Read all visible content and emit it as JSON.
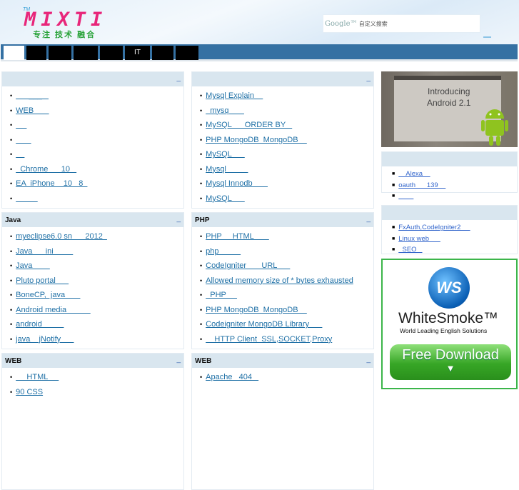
{
  "header": {
    "logo_tm": "TM",
    "logo": "MIXTI",
    "slogan": "专注 技术 融合",
    "search_google": "Google™",
    "search_placeholder": "自定义搜索"
  },
  "nav": {
    "items": [
      "",
      " ",
      " ",
      " ",
      " ",
      "IT",
      " ",
      " "
    ]
  },
  "panels": [
    {
      "title": "",
      "minimize": "_",
      "items": [
        "      ___   ",
        "WEB       ",
        "     ",
        "       ",
        "    ",
        "  Chrome      10   ",
        "EA  iPhone    10   8  ",
        "          "
      ]
    },
    {
      "title": "",
      "minimize": "_",
      "items": [
        "Mysql Explain    ",
        "  mysq       ",
        "MySQL      ORDER BY   ",
        "PHP MongoDB  MongoDB    ",
        "MySQL      ",
        "Mysql          ",
        "Mysql Innodb       ",
        "MySQL      "
      ]
    },
    {
      "title": "Java",
      "minimize": "_",
      "items": [
        "myeclipse6.0 sn      2012  ",
        "Java      ini         ",
        "Java        ",
        "Pluto portal      ",
        "BoneCP,  java       ",
        "Android media           ",
        "android          ",
        "java    jNotify      "
      ]
    },
    {
      "title": "PHP",
      "minimize": "_",
      "items": [
        "PHP     HTML       ",
        "php          ",
        "CodeIgniter       URL      ",
        "Allowed memory size of * bytes exhausted",
        "  PHP     ",
        "PHP MongoDB  MongoDB    ",
        "Codeigniter MongoDB Library      ",
        "    HTTP Client  SSL,SOCKET,Proxy"
      ]
    },
    {
      "title": "WEB",
      "minimize": "_",
      "items": [
        "     HTML     ",
        "90 CSS"
      ]
    },
    {
      "title": "WEB",
      "minimize": "_",
      "items": [
        "Apache   404   "
      ]
    }
  ],
  "side": [
    {
      "title": "",
      "items": [
        "    Alexa    ",
        "oauth      139    ",
        "        "
      ]
    },
    {
      "title": "",
      "items": [
        "FxAuth,CodeIgniter2     ",
        "Linux web      ",
        "  SEO   "
      ]
    }
  ],
  "android_ad": {
    "line1": "Introducing",
    "line2": "Android 2.1"
  },
  "ws_ad": {
    "logo": "WS",
    "brand": "WhiteSmoke™",
    "tagline": "World Leading English Solutions",
    "cta": "Free Download"
  }
}
